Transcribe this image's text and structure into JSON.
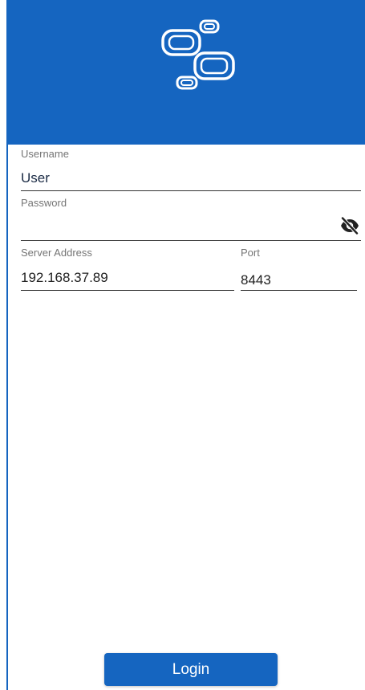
{
  "colors": {
    "primary": "#1565c0",
    "text": "#212121",
    "label": "#757575"
  },
  "header": {
    "logo_icon": "linked-rounded-rectangles-logo"
  },
  "form": {
    "username": {
      "label": "Username",
      "value": "User"
    },
    "password": {
      "label": "Password",
      "value": "",
      "toggle_icon": "eye-off-icon"
    },
    "server": {
      "label": "Server Address",
      "value": "192.168.37.89"
    },
    "port": {
      "label": "Port",
      "value": "8443"
    }
  },
  "actions": {
    "login_label": "Login"
  }
}
